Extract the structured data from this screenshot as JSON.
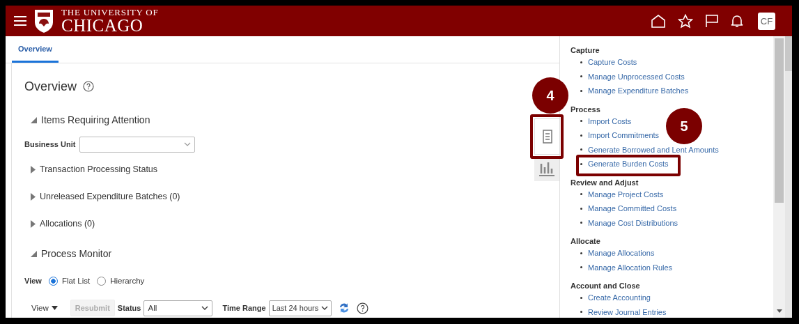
{
  "header": {
    "logo_line1": "THE UNIVERSITY OF",
    "logo_line2": "CHICAGO",
    "avatar": "CF"
  },
  "tabs": [
    {
      "label": "Overview",
      "selected": true
    }
  ],
  "page": {
    "title": "Overview"
  },
  "attention": {
    "title": "Items Requiring Attention",
    "expanded": true,
    "business_unit_label": "Business Unit"
  },
  "subsections": [
    {
      "title": "Transaction Processing Status",
      "expanded": false
    },
    {
      "title": "Unreleased Expenditure Batches (0)",
      "expanded": false
    },
    {
      "title": "Allocations (0)",
      "expanded": false
    }
  ],
  "process_monitor": {
    "title": "Process Monitor",
    "expanded": true,
    "view_label": "View",
    "view_options": [
      {
        "label": "Flat List",
        "selected": true
      },
      {
        "label": "Hierarchy",
        "selected": false
      }
    ],
    "toolbar": {
      "view_menu": "View",
      "resubmit": {
        "label": "Resubmit",
        "disabled": true
      },
      "status_label": "Status",
      "status_value": "All",
      "time_range_label": "Time Range",
      "time_range_value": "Last 24 hours"
    }
  },
  "side_tabs": [
    {
      "kind": "tasks",
      "selected": true
    },
    {
      "kind": "analytics",
      "selected": false
    }
  ],
  "task_panel": {
    "groups": [
      {
        "title": "Capture",
        "links": [
          "Capture Costs",
          "Manage Unprocessed Costs",
          "Manage Expenditure Batches"
        ]
      },
      {
        "title": "Process",
        "links": [
          "Import Costs",
          "Import Commitments",
          "Generate Borrowed and Lent Amounts",
          "Generate Burden Costs"
        ]
      },
      {
        "title": "Review and Adjust",
        "links": [
          "Manage Project Costs",
          "Manage Committed Costs",
          "Manage Cost Distributions"
        ]
      },
      {
        "title": "Allocate",
        "links": [
          "Manage Allocations",
          "Manage Allocation Rules"
        ]
      },
      {
        "title": "Account and Close",
        "links": [
          "Create Accounting",
          "Review Journal Entries"
        ]
      }
    ]
  },
  "callouts": [
    {
      "number": "4"
    },
    {
      "number": "5"
    }
  ]
}
